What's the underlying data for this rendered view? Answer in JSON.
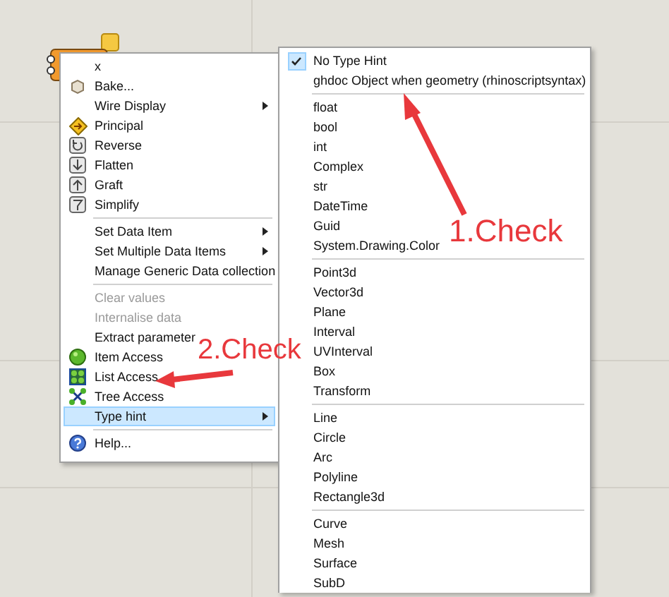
{
  "context_menu": {
    "items": [
      {
        "kind": "item",
        "label": "x",
        "disabled": false,
        "selected": false
      },
      {
        "kind": "item",
        "label": "Bake...",
        "disabled": false,
        "selected": false
      },
      {
        "kind": "submenu",
        "label": "Wire Display",
        "disabled": false,
        "selected": false
      },
      {
        "kind": "item",
        "label": "Principal",
        "disabled": false,
        "selected": false
      },
      {
        "kind": "item",
        "label": "Reverse",
        "disabled": false,
        "selected": false
      },
      {
        "kind": "item",
        "label": "Flatten",
        "disabled": false,
        "selected": false
      },
      {
        "kind": "item",
        "label": "Graft",
        "disabled": false,
        "selected": false
      },
      {
        "kind": "item",
        "label": "Simplify",
        "disabled": false,
        "selected": false
      },
      {
        "kind": "separator"
      },
      {
        "kind": "submenu",
        "label": "Set Data Item",
        "disabled": false,
        "selected": false
      },
      {
        "kind": "submenu",
        "label": "Set Multiple Data Items",
        "disabled": false,
        "selected": false
      },
      {
        "kind": "item",
        "label": "Manage Generic Data collection",
        "disabled": false,
        "selected": false
      },
      {
        "kind": "separator"
      },
      {
        "kind": "item",
        "label": "Clear values",
        "disabled": true,
        "selected": false
      },
      {
        "kind": "item",
        "label": "Internalise data",
        "disabled": true,
        "selected": false
      },
      {
        "kind": "item",
        "label": "Extract parameter",
        "disabled": false,
        "selected": false
      },
      {
        "kind": "item",
        "label": "Item Access",
        "disabled": false,
        "selected": false
      },
      {
        "kind": "item",
        "label": "List Access",
        "disabled": false,
        "selected": false
      },
      {
        "kind": "item",
        "label": "Tree Access",
        "disabled": false,
        "selected": false
      },
      {
        "kind": "submenu",
        "label": "Type hint",
        "disabled": false,
        "selected": true
      },
      {
        "kind": "separator"
      },
      {
        "kind": "item",
        "label": "Help...",
        "disabled": false,
        "selected": false
      }
    ]
  },
  "type_hint_menu": {
    "items": [
      {
        "kind": "item",
        "label": "No Type Hint",
        "checked": true
      },
      {
        "kind": "item",
        "label": "ghdoc Object when geometry (rhinoscriptsyntax)",
        "checked": false
      },
      {
        "kind": "separator"
      },
      {
        "kind": "item",
        "label": "float",
        "checked": false
      },
      {
        "kind": "item",
        "label": "bool",
        "checked": false
      },
      {
        "kind": "item",
        "label": "int",
        "checked": false
      },
      {
        "kind": "item",
        "label": "Complex",
        "checked": false
      },
      {
        "kind": "item",
        "label": "str",
        "checked": false
      },
      {
        "kind": "item",
        "label": "DateTime",
        "checked": false
      },
      {
        "kind": "item",
        "label": "Guid",
        "checked": false
      },
      {
        "kind": "item",
        "label": "System.Drawing.Color",
        "checked": false
      },
      {
        "kind": "separator"
      },
      {
        "kind": "item",
        "label": "Point3d",
        "checked": false
      },
      {
        "kind": "item",
        "label": "Vector3d",
        "checked": false
      },
      {
        "kind": "item",
        "label": "Plane",
        "checked": false
      },
      {
        "kind": "item",
        "label": "Interval",
        "checked": false
      },
      {
        "kind": "item",
        "label": "UVInterval",
        "checked": false
      },
      {
        "kind": "item",
        "label": "Box",
        "checked": false
      },
      {
        "kind": "item",
        "label": "Transform",
        "checked": false
      },
      {
        "kind": "separator"
      },
      {
        "kind": "item",
        "label": "Line",
        "checked": false
      },
      {
        "kind": "item",
        "label": "Circle",
        "checked": false
      },
      {
        "kind": "item",
        "label": "Arc",
        "checked": false
      },
      {
        "kind": "item",
        "label": "Polyline",
        "checked": false
      },
      {
        "kind": "item",
        "label": "Rectangle3d",
        "checked": false
      },
      {
        "kind": "separator"
      },
      {
        "kind": "item",
        "label": "Curve",
        "checked": false
      },
      {
        "kind": "item",
        "label": "Mesh",
        "checked": false
      },
      {
        "kind": "item",
        "label": "Surface",
        "checked": false
      },
      {
        "kind": "item",
        "label": "SubD",
        "checked": false
      }
    ]
  },
  "annotations": [
    {
      "text": "1.Check"
    },
    {
      "text": "2.Check"
    }
  ]
}
